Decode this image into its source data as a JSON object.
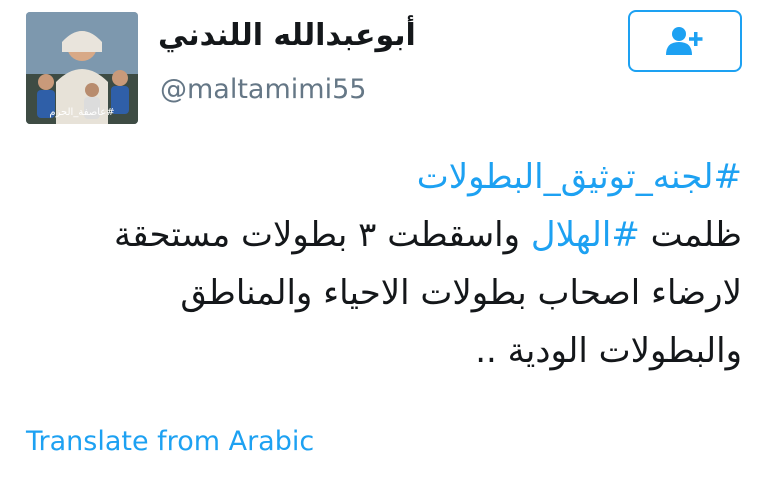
{
  "user": {
    "display_name": "أبوعبدالله اللندني",
    "username": "@maltamimi55",
    "avatar_caption": "#عاصفة_الحزم",
    "avatar_icon": "profile-photo"
  },
  "follow_button": {
    "icon": "add-user-icon",
    "color": "#1da1f2"
  },
  "tweet": {
    "hashtag_1": "#لجنه_توثيق_البطولات",
    "line_2_before": "ظلمت ",
    "hashtag_2": "#الهلال",
    "line_2_after": " واسقطت ٣ بطولات مستحقة",
    "line_3": "لارضاء اصحاب بطولات الاحياء والمناطق",
    "line_4": "والبطولات الودية .."
  },
  "translate": {
    "label": "Translate from Arabic"
  },
  "colors": {
    "accent": "#1da1f2",
    "text": "#14171a",
    "muted": "#657786"
  }
}
